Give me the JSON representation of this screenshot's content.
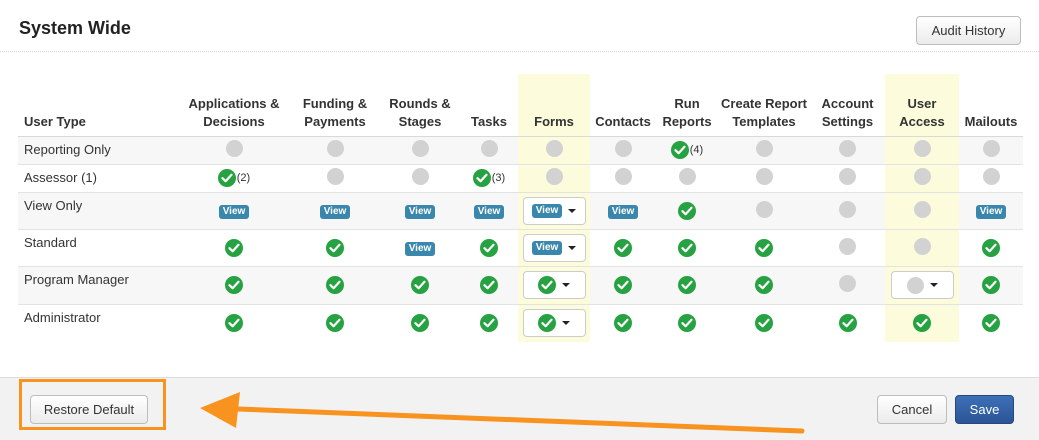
{
  "page": {
    "title": "System Wide"
  },
  "toolbar": {
    "audit_history_label": "Audit History"
  },
  "table": {
    "columns": [
      "User Type",
      "Applications & Decisions",
      "Funding & Payments",
      "Rounds & Stages",
      "Tasks",
      "Forms",
      "Contacts",
      "Run Reports",
      "Create Report Templates",
      "Account Settings",
      "User Access",
      "Mailouts"
    ],
    "highlighted_columns": [
      "Forms",
      "User Access"
    ],
    "rows": [
      {
        "user_type": "Reporting Only",
        "cells": [
          {
            "state": "none"
          },
          {
            "state": "none"
          },
          {
            "state": "none"
          },
          {
            "state": "none"
          },
          {
            "state": "none"
          },
          {
            "state": "none"
          },
          {
            "state": "full",
            "note": "(4)"
          },
          {
            "state": "none"
          },
          {
            "state": "none"
          },
          {
            "state": "none"
          },
          {
            "state": "none"
          }
        ]
      },
      {
        "user_type": "Assessor (1)",
        "cells": [
          {
            "state": "full",
            "note": "(2)"
          },
          {
            "state": "none"
          },
          {
            "state": "none"
          },
          {
            "state": "full",
            "note": "(3)"
          },
          {
            "state": "none"
          },
          {
            "state": "none"
          },
          {
            "state": "none"
          },
          {
            "state": "none"
          },
          {
            "state": "none"
          },
          {
            "state": "none"
          },
          {
            "state": "none"
          }
        ]
      },
      {
        "user_type": "View Only",
        "cells": [
          {
            "state": "view",
            "label": "View"
          },
          {
            "state": "view",
            "label": "View"
          },
          {
            "state": "view",
            "label": "View"
          },
          {
            "state": "view",
            "label": "View"
          },
          {
            "state": "dropdown",
            "value": "view",
            "label": "View"
          },
          {
            "state": "view",
            "label": "View"
          },
          {
            "state": "full"
          },
          {
            "state": "none"
          },
          {
            "state": "none"
          },
          {
            "state": "none"
          },
          {
            "state": "view",
            "label": "View"
          }
        ]
      },
      {
        "user_type": "Standard",
        "cells": [
          {
            "state": "full"
          },
          {
            "state": "full"
          },
          {
            "state": "view",
            "label": "View"
          },
          {
            "state": "full"
          },
          {
            "state": "dropdown",
            "value": "view",
            "label": "View"
          },
          {
            "state": "full"
          },
          {
            "state": "full"
          },
          {
            "state": "full"
          },
          {
            "state": "none"
          },
          {
            "state": "none"
          },
          {
            "state": "full"
          }
        ]
      },
      {
        "user_type": "Program Manager",
        "cells": [
          {
            "state": "full"
          },
          {
            "state": "full"
          },
          {
            "state": "full"
          },
          {
            "state": "full"
          },
          {
            "state": "dropdown",
            "value": "full"
          },
          {
            "state": "full"
          },
          {
            "state": "full"
          },
          {
            "state": "full"
          },
          {
            "state": "none"
          },
          {
            "state": "dropdown",
            "value": "none"
          },
          {
            "state": "full"
          }
        ]
      },
      {
        "user_type": "Administrator",
        "cells": [
          {
            "state": "full"
          },
          {
            "state": "full"
          },
          {
            "state": "full"
          },
          {
            "state": "full"
          },
          {
            "state": "dropdown",
            "value": "full"
          },
          {
            "state": "full"
          },
          {
            "state": "full"
          },
          {
            "state": "full"
          },
          {
            "state": "full"
          },
          {
            "state": "full"
          },
          {
            "state": "full"
          }
        ]
      }
    ]
  },
  "footer": {
    "restore_default_label": "Restore Default",
    "cancel_label": "Cancel",
    "save_label": "Save"
  },
  "annotation": {
    "highlight_color": "#f7931e"
  },
  "colors": {
    "check_green": "#27a242",
    "view_badge": "#3a87ad",
    "highlight_column": "#fcfcdc",
    "save_button": "#2c5595"
  }
}
